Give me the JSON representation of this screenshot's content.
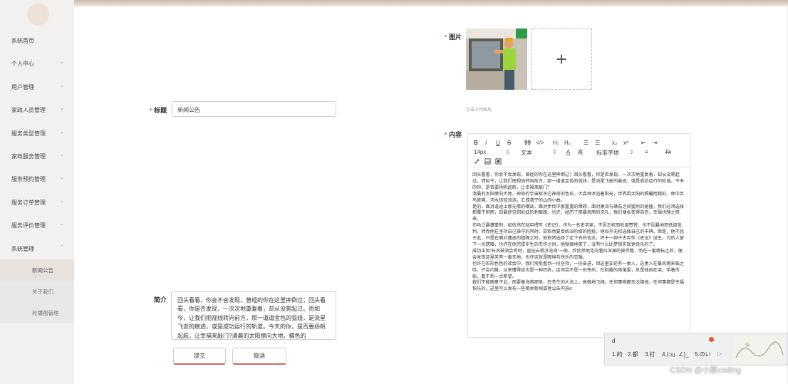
{
  "sidebar": {
    "items": [
      {
        "label": "系统首页"
      },
      {
        "label": "个人中心"
      },
      {
        "label": "用户管理"
      },
      {
        "label": "家政人员管理"
      },
      {
        "label": "服务类型管理"
      },
      {
        "label": "家政服务管理"
      },
      {
        "label": "服务预约管理"
      },
      {
        "label": "服务订单管理"
      },
      {
        "label": "服务评价管理"
      },
      {
        "label": "系统管理"
      }
    ],
    "subitems": [
      {
        "label": "新闻公告"
      },
      {
        "label": "关于我们"
      },
      {
        "label": "轮播图管理"
      }
    ]
  },
  "form": {
    "image_label": "图片",
    "image_hint": "点击上传图片",
    "add_symbol": "+",
    "title_label": "标题",
    "title_value": "新闻公告",
    "content_label": "内容",
    "summary_label": "简介",
    "summary_value": "回头看看，你会不会发现，曾经的你在这里摔倒过；回头看看，你是否发现，一次次地重复着，却从没爬起过。而如今，让我们把视线转向前方，那一道道金色的弧线，是流星飞逝的痕迹，或是成功运行的轨道。今天的你，是否要扬帆起航，让幸福来敲门?清晨的太阳擦向大地，橘色的",
    "required_mark": "*"
  },
  "editor": {
    "toolbar": {
      "bold": "B",
      "italic": "I",
      "underline": "U",
      "strike": "S",
      "quote": "99",
      "code": "</>",
      "h1": "H₁",
      "h2": "H₂",
      "ol": "☰",
      "ul": "☰",
      "sub": "x₂",
      "sup": "x²",
      "outdent": "⇤",
      "indent": "⇥",
      "size": "14px",
      "heading": "文本",
      "color": "A",
      "bg": "A",
      "font": "标准字体",
      "align": "≡",
      "clear": "Tx"
    },
    "paragraphs": [
      "回头看看，你会不会发现，曾经的你在这里摔倒过；回头看看，你是否发现，一次次地重复着，却从没爬起过。而如今，让我们把视线转向前方，那一道道金色的弧线，是流星飞逝的痕迹，或是成功运行的轨道。今天的你，是否要扬帆起航，让幸福来敲门？",
      "清晨的太阳擦向大地，神奇的宇宙赋予它神奇的色彩。大森林沐浴着阳光，世界因太阳的照耀而精彩。林中百鸟歌唱，河水轻轻流淌，汇成清宁的山间小曲。",
      "是的，面对道途上那无情的嘲讽，面对步伐中那重重的障碍，面对激流与礁石之间猛烈的碰撞，我们必须选择那覆于阴雨，却最终见到彩虹的刺眼路。也许，经历了那暴风雨的洗礼，我们便会变得自信，幸福也随之而来。",
      "司马迁暴遭重刑，如依然在狱中撰写《史记》，作为一名史学家，不因王权而低度赞赏，也不因暴地而低度批判。然而他在坚持自己操守的同时，却依然要受统治阶级的阻挠，他似乎无权选择自己的丰碑。但是，他不屈于此，只是在面对遭途的阻隔之时，他依然选择了走下去的信念。终于一部千古巨作《史记》诞生，为后人留下一份遗赠，也许在他完成毕生的杰作之时，他微微地笑了，没有什么比梦想实现更快乐的了。",
      "成功正如“长风破浪会有时，直挂云帆济沧海”一般，欣欣然地走向看似深渊的彼岸路，而在一番耕耘之后，便会发现这里另有一番天地，也许这就是困境与快乐的交融。",
      "也许在形形色色的社会中，我们常能看到一份坚持，一份奋进，但这里却还有一类人，这类人在暴风雨来临之际，只会闪躲，从来懂得这也是一种历练，这何尝不是一份快乐。在阴霾的角落里，总是独自在哭，带着伤影，看不到一点希望。",
      "我们不能随意于此，而要像海燕那般，在苍茫的大海上，高傲地飞翔，任何事物都无法阻挡，任何事都是幸福快乐的。这里可以发布一些相关新闻或者公告内容d"
    ]
  },
  "buttons": {
    "submit": "提交",
    "cancel": "取消"
  },
  "ime": {
    "input": "d",
    "candidates": [
      "1.的",
      "2.都",
      "3.打",
      "4.(:з」∠)_",
      "5.のい"
    ],
    "next": "▷"
  },
  "watermark": "CSDN @小蔡coding"
}
